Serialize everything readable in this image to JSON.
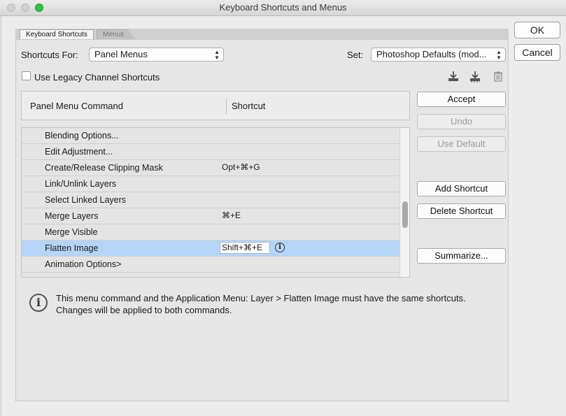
{
  "window": {
    "title": "Keyboard Shortcuts and Menus"
  },
  "tabs": [
    {
      "label": "Keyboard Shortcuts",
      "active": true
    },
    {
      "label": "Menus",
      "active": false
    }
  ],
  "shortcuts_for": {
    "label": "Shortcuts For:",
    "value": "Panel Menus"
  },
  "set": {
    "label": "Set:",
    "value": "Photoshop Defaults (mod..."
  },
  "legacy": {
    "label": "Use Legacy Channel Shortcuts",
    "checked": false
  },
  "set_icons": [
    "save-set-icon",
    "save-set-as-icon",
    "delete-set-icon"
  ],
  "table": {
    "col_command": "Panel Menu Command",
    "col_shortcut": "Shortcut",
    "rows": [
      {
        "command": "Blending Options...",
        "shortcut": ""
      },
      {
        "command": "Edit Adjustment...",
        "shortcut": ""
      },
      {
        "command": "Create/Release Clipping Mask",
        "shortcut": "Opt+⌘+G"
      },
      {
        "command": "Link/Unlink Layers",
        "shortcut": ""
      },
      {
        "command": "Select Linked Layers",
        "shortcut": ""
      },
      {
        "command": "Merge Layers",
        "shortcut": "⌘+E"
      },
      {
        "command": "Merge Visible",
        "shortcut": ""
      },
      {
        "command": "Flatten Image",
        "shortcut": "Shift+⌘+E",
        "selected": true
      },
      {
        "command": "Animation Options>",
        "shortcut": ""
      }
    ]
  },
  "buttons": {
    "ok": "OK",
    "cancel": "Cancel",
    "accept": "Accept",
    "undo": "Undo",
    "use_default": "Use Default",
    "add_shortcut": "Add Shortcut",
    "delete_shortcut": "Delete Shortcut",
    "summarize": "Summarize..."
  },
  "message": {
    "line1": "This menu command and the Application Menu: Layer > Flatten Image must have the same shortcuts.",
    "line2": "Changes will be applied to both commands."
  },
  "colors": {
    "selection": "#b5d5f7",
    "zoom_button": "#2fc244"
  }
}
